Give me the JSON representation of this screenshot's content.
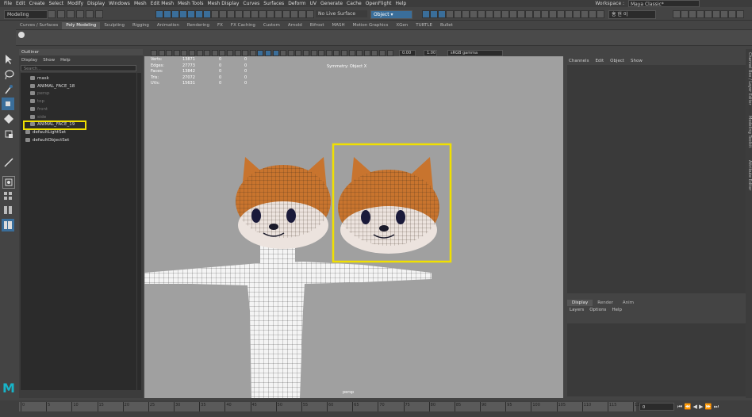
{
  "menu": [
    "File",
    "Edit",
    "Create",
    "Select",
    "Modify",
    "Display",
    "Windows",
    "Mesh",
    "Edit Mesh",
    "Mesh Tools",
    "Mesh Display",
    "Curves",
    "Surfaces",
    "Deform",
    "UV",
    "Generate",
    "Cache",
    "OpenFlight",
    "Help"
  ],
  "workspace": {
    "label": "Workspace :",
    "value": "Maya Classic*"
  },
  "status": {
    "mode": "Modeling",
    "live_surface": "No Live Surface",
    "object_mode": "Object ▾",
    "user": "홍 현 이"
  },
  "shelf_tabs": [
    "Curves / Surfaces",
    "Poly Modeling",
    "Sculpting",
    "Rigging",
    "Animation",
    "Rendering",
    "FX",
    "FX Caching",
    "Custom",
    "Arnold",
    "Bifrost",
    "MASH",
    "Motion Graphics",
    "XGen",
    "TURTLE",
    "Bullet"
  ],
  "shelf_active": "Poly Modeling",
  "outliner": {
    "title": "Outliner",
    "menu": [
      "Display",
      "Show",
      "Help"
    ],
    "search_placeholder": "Search...",
    "items": [
      {
        "label": "mask",
        "dim": false
      },
      {
        "label": "ANIMAL_FACE_18",
        "dim": false
      },
      {
        "label": "persp",
        "dim": true
      },
      {
        "label": "top",
        "dim": true
      },
      {
        "label": "front",
        "dim": true
      },
      {
        "label": "side",
        "dim": true
      },
      {
        "label": "ANIMAL_FACE_19",
        "dim": false
      },
      {
        "label": "defaultLightSet",
        "dim": false
      },
      {
        "label": "defaultObjectSet",
        "dim": false
      }
    ]
  },
  "viewport": {
    "camera": "persp",
    "exposure": "0.00",
    "gamma": "1.00",
    "color_space": "sRGB gamma",
    "symmetry": "Symmetry: Object X",
    "hud": [
      {
        "label": "Verts:",
        "v1": "13871",
        "v2": "0",
        "v3": "0"
      },
      {
        "label": "Edges:",
        "v1": "27773",
        "v2": "0",
        "v3": "0"
      },
      {
        "label": "Faces:",
        "v1": "13842",
        "v2": "0",
        "v3": "0"
      },
      {
        "label": "Tris:",
        "v1": "27072",
        "v2": "0",
        "v3": "0"
      },
      {
        "label": "UVs:",
        "v1": "15631",
        "v2": "0",
        "v3": "0"
      }
    ]
  },
  "channel_box": {
    "menu": [
      "Channels",
      "Edit",
      "Object",
      "Show"
    ]
  },
  "layer_editor": {
    "tabs": [
      "Display",
      "Render",
      "Anim"
    ],
    "menu": [
      "Layers",
      "Options",
      "Help"
    ]
  },
  "side_tabs": [
    "Channel Box / Layer Editor",
    "Modeling Toolkit",
    "Attribute Editor"
  ],
  "timeline": {
    "ticks": [
      "0",
      "5",
      "10",
      "15",
      "20",
      "25",
      "30",
      "35",
      "40",
      "45",
      "50",
      "55",
      "60",
      "65",
      "70",
      "75",
      "80",
      "85",
      "90",
      "95",
      "100",
      "105",
      "110",
      "115",
      "120"
    ],
    "current_frame": "0"
  },
  "logo": "M",
  "colors": {
    "highlight": "#f0e000",
    "viewport_bg": "#a0a0a0",
    "accent": "#3a6e9a"
  }
}
